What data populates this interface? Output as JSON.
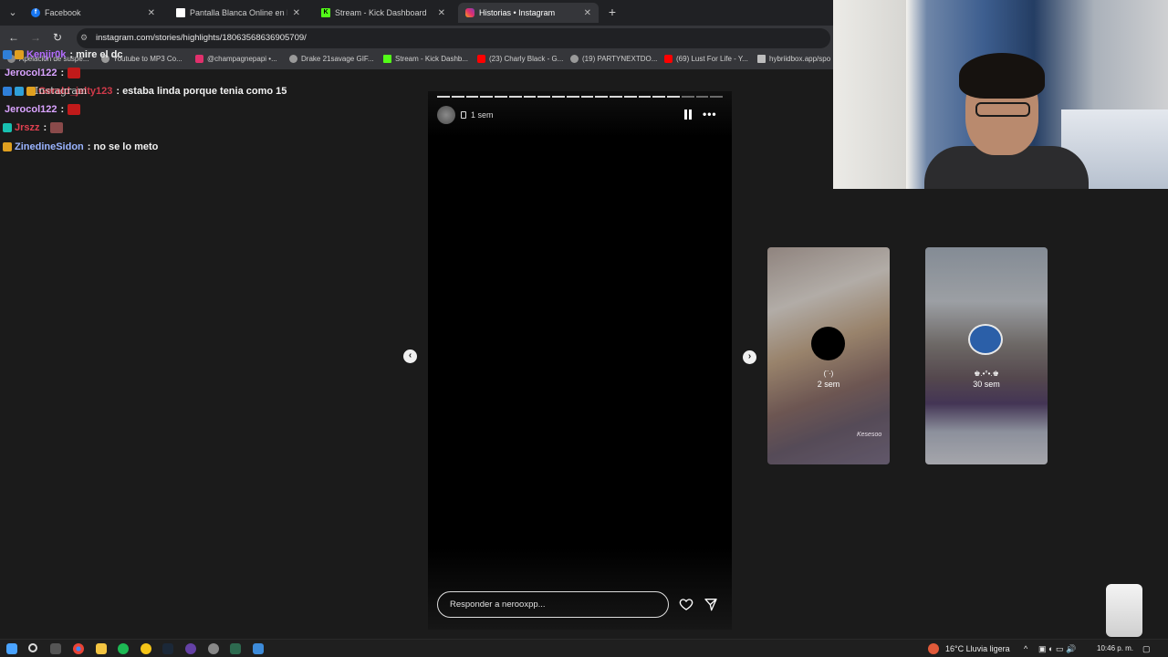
{
  "browser": {
    "tabs": [
      {
        "label": "Facebook",
        "icon": "facebook-icon",
        "color": "#1877f2"
      },
      {
        "label": "Pantalla Blanca Online en Pantall",
        "icon": "page-icon",
        "color": "#ffffff"
      },
      {
        "label": "Stream - Kick Dashboard",
        "icon": "kick-icon",
        "color": "#53fc18"
      },
      {
        "label": "Historias • Instagram",
        "icon": "instagram-icon",
        "color": "#e1306c"
      }
    ],
    "url": "instagram.com/stories/highlights/18063568636905709/",
    "bookmarks": [
      "Apelación de suspe...",
      "Youtube to MP3 Co...",
      "@champagnepapi •...",
      "Drake 21savage GIF...",
      "Stream - Kick Dashb...",
      "(23) Charly Black - G...",
      "(19) PARTYNEXTDO...",
      "(69) Lust For Life - Y...",
      "hybriidbox.app/spo"
    ]
  },
  "chat": [
    {
      "user": "Kenjir0k",
      "color": "#b46cff",
      "message": ": mire el dc"
    },
    {
      "user": "Jerocol122",
      "color": "#d9a3ff",
      "message": ":"
    },
    {
      "user": "Gerald_jelty123",
      "color": "#d23a4a",
      "message": ": estaba linda porque tenia como 15"
    },
    {
      "user": "Jerocol122",
      "color": "#d9a3ff",
      "message": ":"
    },
    {
      "user": "Jrszz",
      "color": "#e04050",
      "message": ":"
    },
    {
      "user": "ZinedineSidon",
      "color": "#9ab4ff",
      "message": ": no se lo meto"
    }
  ],
  "story": {
    "overlay_text": "Instagram",
    "time": "1 sem",
    "progress_segments": 20,
    "progress_done": 17,
    "reply_placeholder": "Responder a nerooxpp..."
  },
  "highlights": [
    {
      "title": "(¨·)",
      "time": "2 sem",
      "watermark": "Kesesoo"
    },
    {
      "title": "♚.•°•.♚",
      "time": "30 sem"
    }
  ],
  "taskbar": {
    "weather": "16°C  Lluvia ligera",
    "clock": "10:46 p. m."
  }
}
